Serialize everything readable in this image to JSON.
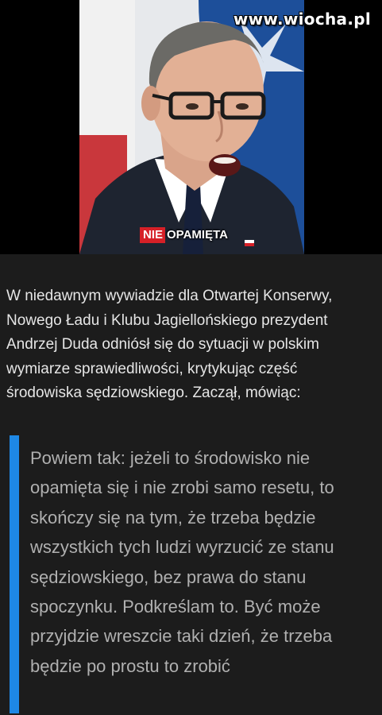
{
  "media": {
    "watermark": "www.wiocha.pl",
    "caption_highlight": "NIE",
    "caption_rest": "OPAMIĘTA"
  },
  "article": {
    "intro": "W niedawnym wywiadzie dla Otwartej Konserwy, Nowego Ładu i Klubu Jagiellońskiego prezydent Andrzej Duda odniósł się do sytuacji w polskim wymiarze sprawiedliwości, krytykując część środowiska sędziowskiego. Zaczął, mówiąc:",
    "quote": "Powiem tak: jeżeli to środowisko nie opamięta się i nie zrobi samo resetu, to skończy się na tym, że trzeba będzie wszystkich tych ludzi wyrzucić ze stanu sędziowskiego, bez prawa do stanu spoczynku. Podkreślam to. Być może przyjdzie wreszcie taki dzień, że trzeba będzie po prostu to zrobić"
  },
  "colors": {
    "page_background": "#1c1c1c",
    "quote_bar": "#1e88e5",
    "caption_red": "#d62027",
    "intro_text": "#e6e6e6",
    "quote_text": "#b0b0b0"
  }
}
